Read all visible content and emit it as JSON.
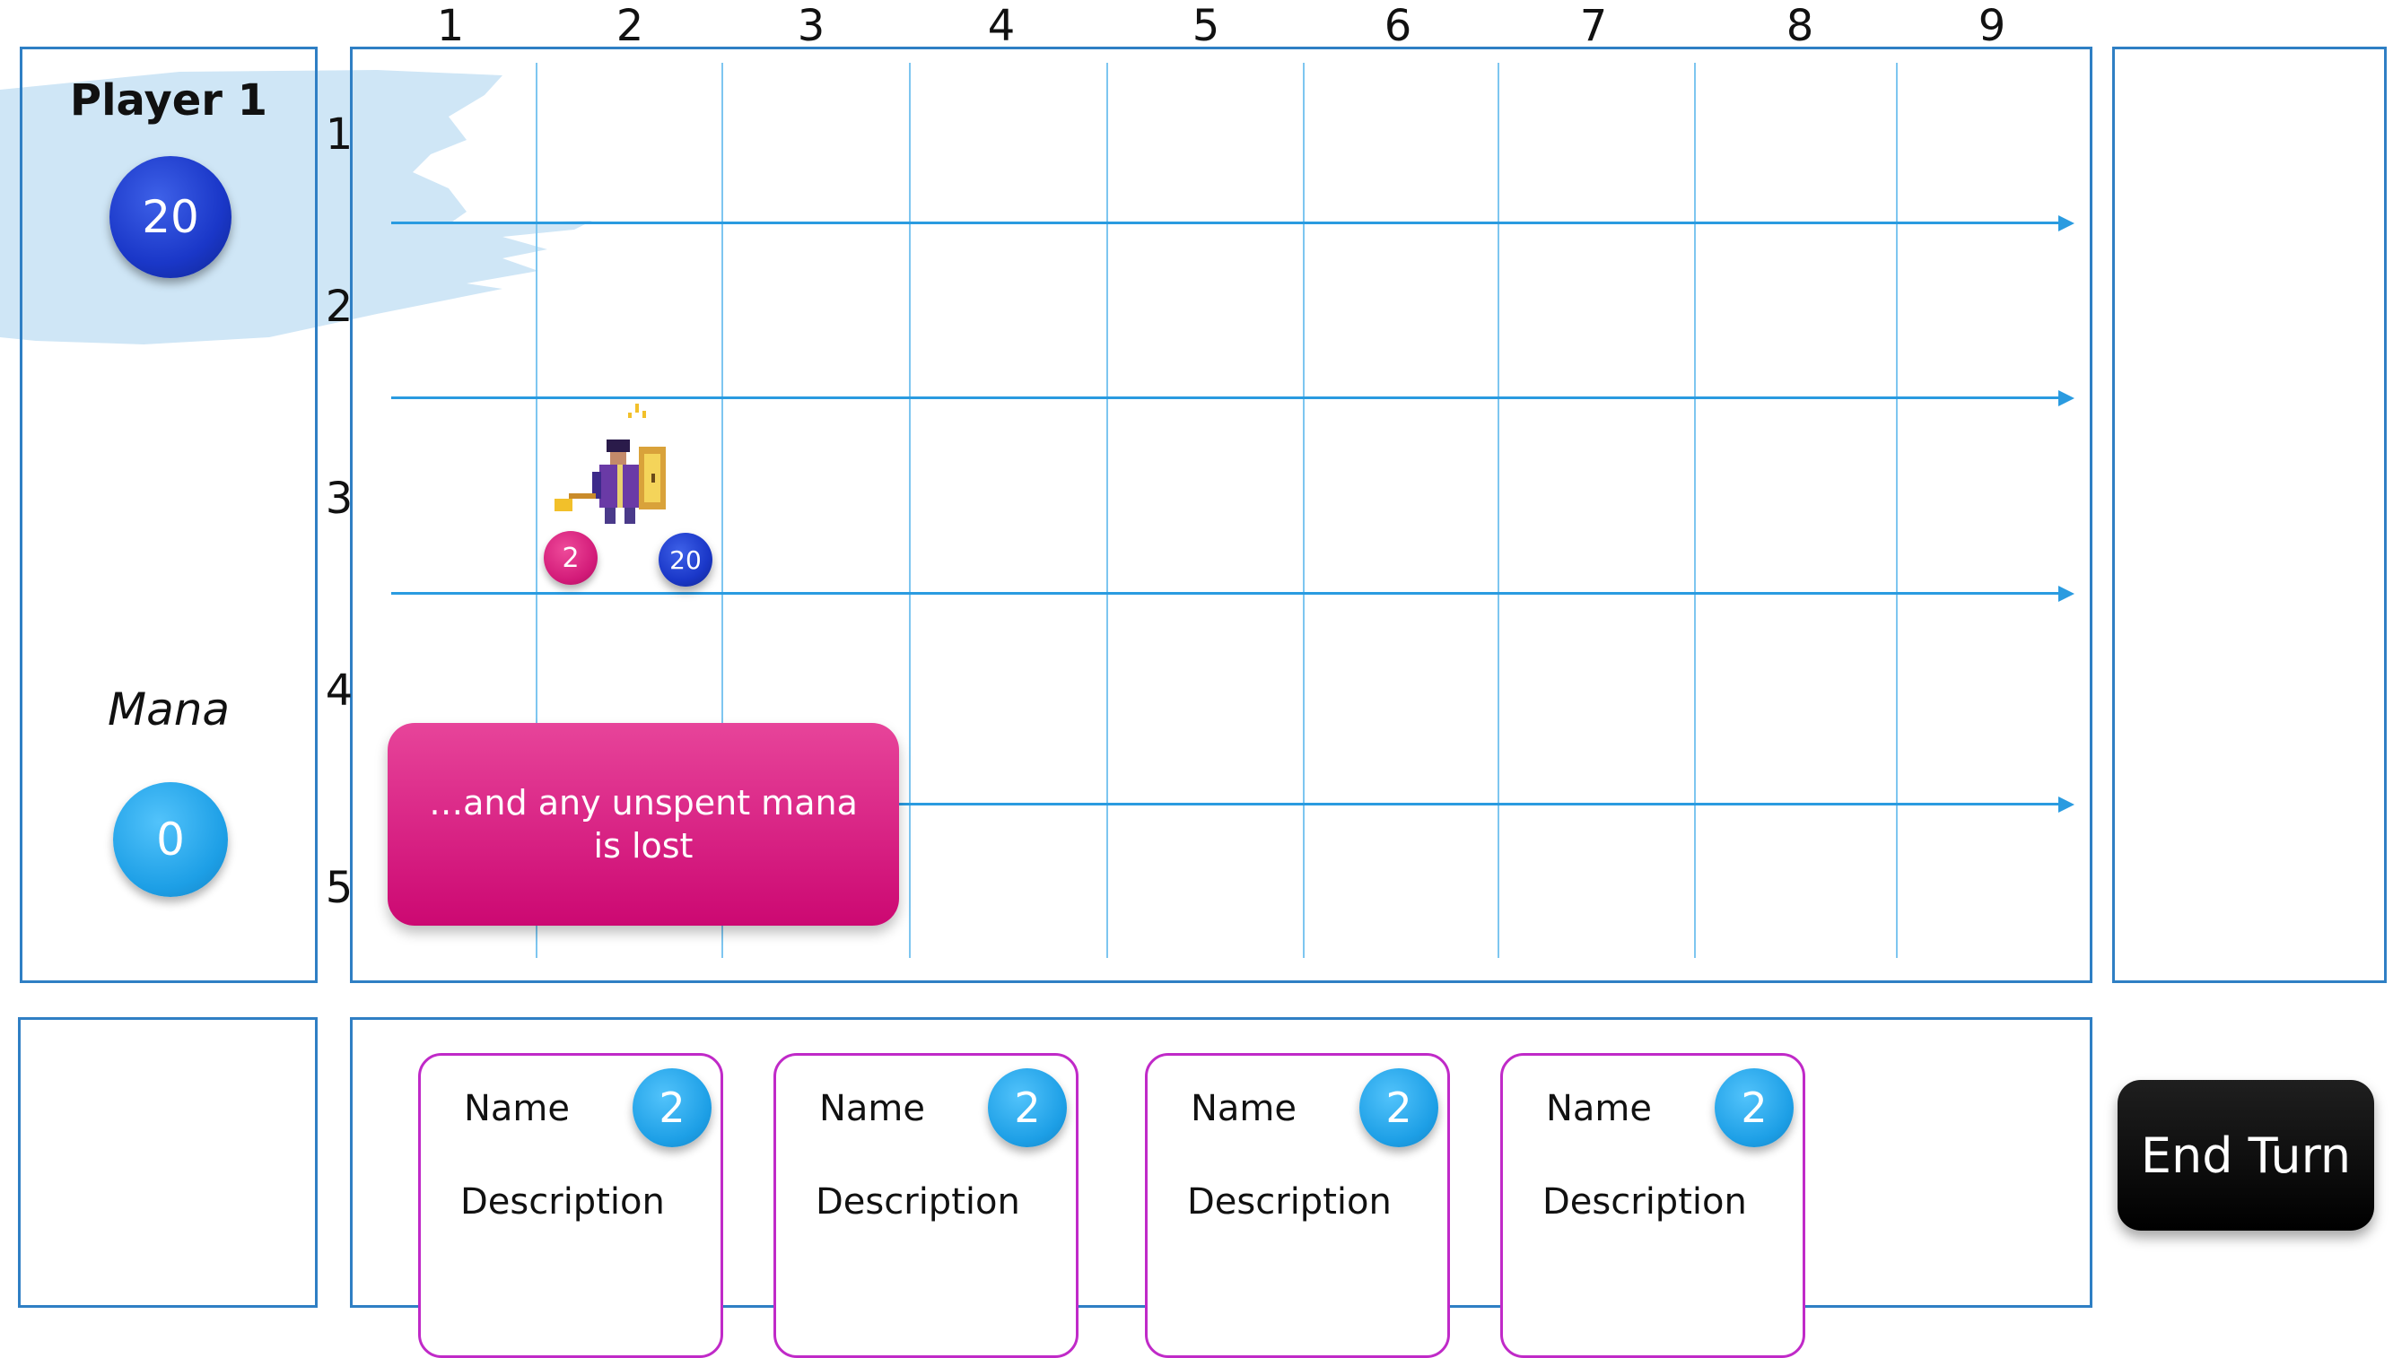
{
  "board": {
    "columns": [
      "1",
      "2",
      "3",
      "4",
      "5",
      "6",
      "7",
      "8",
      "9"
    ],
    "rows": [
      "1",
      "2",
      "3",
      "4",
      "5"
    ]
  },
  "player": {
    "name": "Player 1",
    "health": "20",
    "mana_label": "Mana",
    "mana": "0"
  },
  "unit": {
    "attack": "2",
    "health": "20",
    "icon": "wizard-sprite-icon"
  },
  "tooltip": {
    "text": "…and any unspent mana is lost"
  },
  "hand": {
    "cards": [
      {
        "name": "Name",
        "description": "Description",
        "cost": "2"
      },
      {
        "name": "Name",
        "description": "Description",
        "cost": "2"
      },
      {
        "name": "Name",
        "description": "Description",
        "cost": "2"
      },
      {
        "name": "Name",
        "description": "Description",
        "cost": "2"
      }
    ]
  },
  "controls": {
    "end_turn_label": "End Turn"
  },
  "colors": {
    "panel_border": "#2f7fc4",
    "grid_line": "#7ec6f0",
    "lane_arrow": "#2a9be0",
    "card_border": "#c02ac8",
    "tooltip_pink": "#d7127d",
    "health_blue": "#1a37c8",
    "mana_cyan": "#1d9fe6",
    "highlight": "#cfe6f6"
  }
}
